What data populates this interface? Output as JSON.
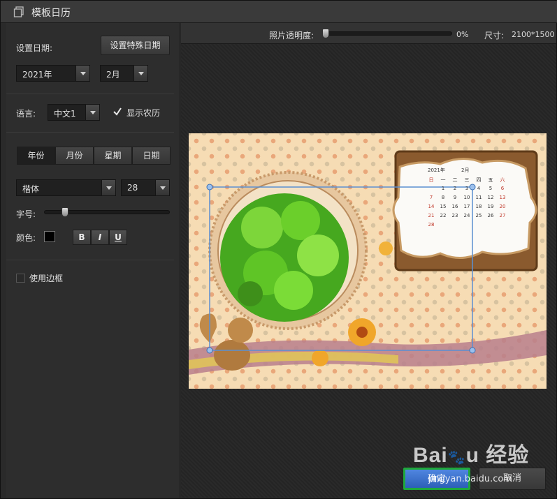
{
  "window": {
    "title": "模板日历"
  },
  "left": {
    "set_date_label": "设置日期:",
    "special_date_button": "设置特殊日期",
    "year": {
      "value": "2021年"
    },
    "month": {
      "value": "2月"
    },
    "language_label": "语言:",
    "language": {
      "value": "中文1"
    },
    "show_lunar": {
      "label": "显示农历",
      "checked": true
    },
    "tabs": [
      {
        "label": "年份"
      },
      {
        "label": "月份"
      },
      {
        "label": "星期"
      },
      {
        "label": "日期"
      }
    ],
    "font": {
      "value": "楷体"
    },
    "font_size": {
      "value": "28"
    },
    "size_label": "字号:",
    "color_label": "颜色:",
    "color_value": "#000000",
    "format_buttons": [
      {
        "label": "B"
      },
      {
        "label": "I"
      },
      {
        "label": "U"
      }
    ],
    "use_border": {
      "label": "使用边框",
      "checked": false
    }
  },
  "toolbar": {
    "opacity_label": "照片透明度:",
    "opacity_value": "0%",
    "size_label": "尺寸:",
    "size_value": "2100*1500"
  },
  "calendar_preview": {
    "year": "2021年",
    "month": "2月",
    "weekdays": [
      "日",
      "一",
      "二",
      "三",
      "四",
      "五",
      "六"
    ],
    "rows": [
      [
        "",
        "1",
        "2",
        "3",
        "4",
        "5",
        "6"
      ],
      [
        "7",
        "8",
        "9",
        "10",
        "11",
        "12",
        "13"
      ],
      [
        "14",
        "15",
        "16",
        "17",
        "18",
        "19",
        "20"
      ],
      [
        "21",
        "22",
        "23",
        "24",
        "25",
        "26",
        "27"
      ],
      [
        "28",
        "",
        "",
        "",
        "",
        "",
        ""
      ]
    ]
  },
  "footer": {
    "ok_label": "确定",
    "cancel_label": "取消",
    "watermark": "Baidu 经验 jingyan.baidu.com"
  },
  "colors": {
    "panel": "#2d2d2d",
    "accent": "#3b6fd4",
    "highlight_border": "#1ea83c"
  }
}
